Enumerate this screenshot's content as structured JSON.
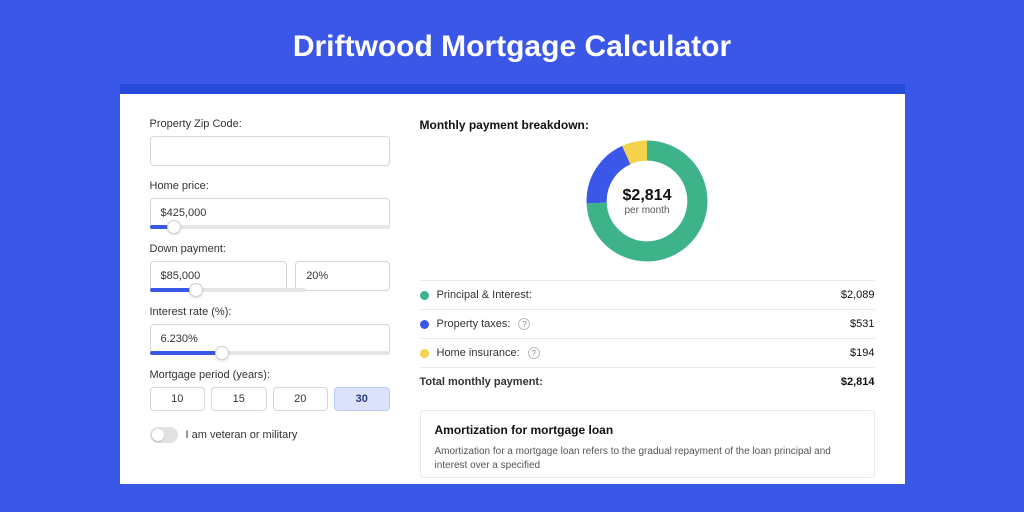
{
  "page_title": "Driftwood Mortgage Calculator",
  "form": {
    "zip_label": "Property Zip Code:",
    "zip_value": "",
    "home_price_label": "Home price:",
    "home_price_value": "$425,000",
    "down_payment_label": "Down payment:",
    "down_payment_amount": "$85,000",
    "down_payment_percent": "20%",
    "interest_rate_label": "Interest rate (%):",
    "interest_rate_value": "6.230%",
    "mortgage_period_label": "Mortgage period (years):",
    "periods": [
      {
        "label": "10",
        "active": false
      },
      {
        "label": "15",
        "active": false
      },
      {
        "label": "20",
        "active": false
      },
      {
        "label": "30",
        "active": true
      }
    ],
    "veteran_label": "I am veteran or military"
  },
  "breakdown": {
    "heading": "Monthly payment breakdown:",
    "center_amount": "$2,814",
    "center_period": "per month",
    "items": [
      {
        "label": "Principal & Interest:",
        "value": "$2,089",
        "dot": "c-green",
        "has_info": false
      },
      {
        "label": "Property taxes:",
        "value": "$531",
        "dot": "c-blue",
        "has_info": true
      },
      {
        "label": "Home insurance:",
        "value": "$194",
        "dot": "c-yellow",
        "has_info": true
      }
    ],
    "total_label": "Total monthly payment:",
    "total_value": "$2,814"
  },
  "amortization": {
    "title": "Amortization for mortgage loan",
    "body": "Amortization for a mortgage loan refers to the gradual repayment of the loan principal and interest over a specified"
  },
  "chart_data": {
    "type": "pie",
    "title": "Monthly payment breakdown",
    "series": [
      {
        "name": "Principal & Interest",
        "value": 2089,
        "color": "#3eb38a"
      },
      {
        "name": "Property taxes",
        "value": 531,
        "color": "#3a57e8"
      },
      {
        "name": "Home insurance",
        "value": 194,
        "color": "#f4d24b"
      }
    ],
    "total": 2814,
    "unit": "USD per month"
  },
  "colors": {
    "brand_blue": "#3a57e8",
    "dark_blue": "#274bdb",
    "green": "#3eb38a",
    "yellow": "#f4d24b"
  }
}
